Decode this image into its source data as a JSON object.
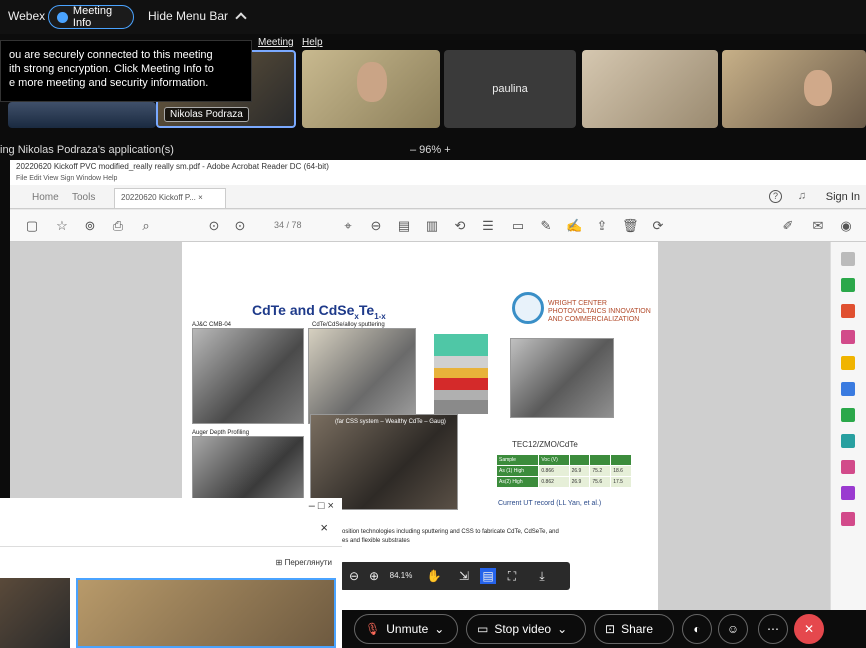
{
  "topbar": {
    "brand": "Webex",
    "meeting_info": "Meeting Info",
    "hide_menu_bar": "Hide Menu Bar"
  },
  "tooltip": {
    "line1": "ou are securely connected to this meeting",
    "line2": "ith strong encryption. Click Meeting Info to",
    "line3": "e more meeting and security information."
  },
  "menu": {
    "meeting": "Meeting",
    "help": "Help"
  },
  "participants": {
    "tile2_name": "Nikolas Podraza",
    "tile4_name": "paulina"
  },
  "sharing": {
    "label": "ing Nikolas Podraza's application(s)",
    "zoom": "–   96%   +"
  },
  "acrobat": {
    "title": "20220620 Kickoff PVC modified_really really sm.pdf - Adobe Acrobat Reader DC (64-bit)",
    "menu": "File   Edit   View   Sign   Window   Help",
    "tab_home": "Home",
    "tab_tools": "Tools",
    "tab_doc": "20220620 Kickoff P... ×",
    "sign_in": "Sign In",
    "page_info": "34 / 78"
  },
  "slide": {
    "title_main": "CdTe and CdSe",
    "title_sub_x": "x",
    "title_te": "Te",
    "title_sub_1x": "1-x",
    "cap1": "AJ&C CMB-04",
    "cap2": "CdTe/CdSe/alloy sputtering",
    "cap3": "Auger Depth Profiling",
    "cap4": "(far CSS system – Wealthy CdTe – Gaug)",
    "wright_text1": "WRIGHT CENTER",
    "wright_text2": "PHOTOVOLTAICS INNOVATION",
    "wright_text3": "AND COMMERCIALIZATION",
    "tec_label": "TEC12/ZMO/CdTe",
    "table": [
      [
        "Sample",
        "Voc (V)",
        "",
        "",
        ""
      ],
      [
        "As (1) High",
        "0.866",
        "26.9",
        "75.2",
        "18.6"
      ],
      [
        "As(2) High",
        "0.862",
        "26.9",
        "75.6",
        "17.5"
      ]
    ],
    "ut_record": "Current UT record (LL Yan, et al.)",
    "text_line1": "osition technologies including sputtering and  CSS to fabricate CdTe, CdSeTe, and",
    "text_line2": "es and flexible substrates"
  },
  "pdf_float": {
    "zoom": "84.1%"
  },
  "sidewin": {
    "controls": "–   □   ×",
    "close": "×",
    "preview": "⊞ Переглянути"
  },
  "controls": {
    "unmute": "Unmute",
    "stop_video": "Stop video",
    "share": "Share"
  },
  "colors": {
    "accent": "#4aa3ff",
    "end_call": "#e5484d",
    "mic_muted": "#ff6b5b",
    "slide_title": "#1e3a8a"
  }
}
